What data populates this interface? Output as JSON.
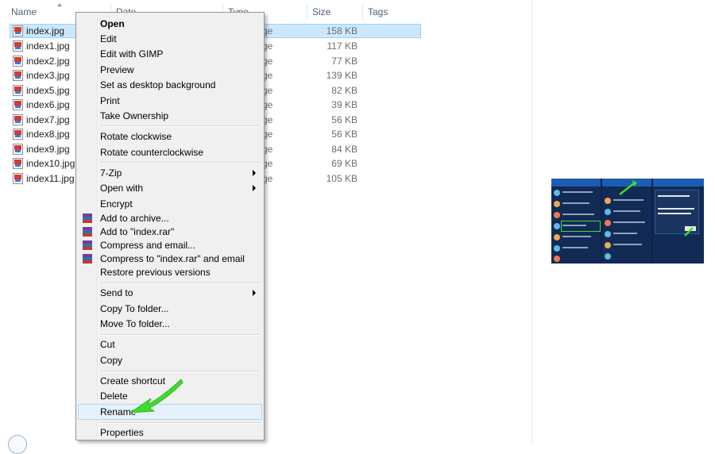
{
  "columns": {
    "name": "Name",
    "date": "Date",
    "type": "Type",
    "size": "Size",
    "tags": "Tags"
  },
  "files": [
    {
      "name": "index.jpg",
      "type": "ge",
      "size": "158 KB",
      "selected": true
    },
    {
      "name": "index1.jpg",
      "type": "ge",
      "size": "117 KB"
    },
    {
      "name": "index2.jpg",
      "type": "ge",
      "size": "77 KB"
    },
    {
      "name": "index3.jpg",
      "type": "ge",
      "size": "139 KB"
    },
    {
      "name": "index5.jpg",
      "type": "ge",
      "size": "82 KB"
    },
    {
      "name": "index6.jpg",
      "type": "ge",
      "size": "39 KB"
    },
    {
      "name": "index7.jpg",
      "type": "ge",
      "size": "56 KB"
    },
    {
      "name": "index8.jpg",
      "type": "ge",
      "size": "56 KB"
    },
    {
      "name": "index9.jpg",
      "type": "ge",
      "size": "84 KB"
    },
    {
      "name": "index10.jpg",
      "type": "ge",
      "size": "69 KB"
    },
    {
      "name": "index11.jpg",
      "type": "ge",
      "size": "105 KB"
    }
  ],
  "context_menu": {
    "open": "Open",
    "edit": "Edit",
    "edit_with_gimp": "Edit with GIMP",
    "preview": "Preview",
    "set_desktop_background": "Set as desktop background",
    "print": "Print",
    "take_ownership": "Take Ownership",
    "rotate_clockwise": "Rotate clockwise",
    "rotate_counterclockwise": "Rotate counterclockwise",
    "seven_zip": "7-Zip",
    "open_with": "Open with",
    "encrypt": "Encrypt",
    "add_to_archive": "Add to archive...",
    "add_to_rar": "Add to \"index.rar\"",
    "compress_and_email": "Compress and email...",
    "compress_to_rar_and_email": "Compress to \"index.rar\" and email",
    "restore_previous_versions": "Restore previous versions",
    "send_to": "Send to",
    "copy_to_folder": "Copy To folder...",
    "move_to_folder": "Move To folder...",
    "cut": "Cut",
    "copy": "Copy",
    "create_shortcut": "Create shortcut",
    "delete": "Delete",
    "rename": "Rename",
    "properties": "Properties"
  },
  "colors": {
    "selection_bg": "#cce8ff",
    "selection_border": "#99d1ff",
    "menu_bg": "#f0f0f0",
    "menu_hover": "#e5f1fb",
    "annotation_arrow": "#3fdc2e"
  },
  "icons": {
    "file": "jpg-file-icon",
    "archive": "winrar-icon",
    "submenu": "chevron-right-icon",
    "annotation": "green-arrow-icon"
  }
}
